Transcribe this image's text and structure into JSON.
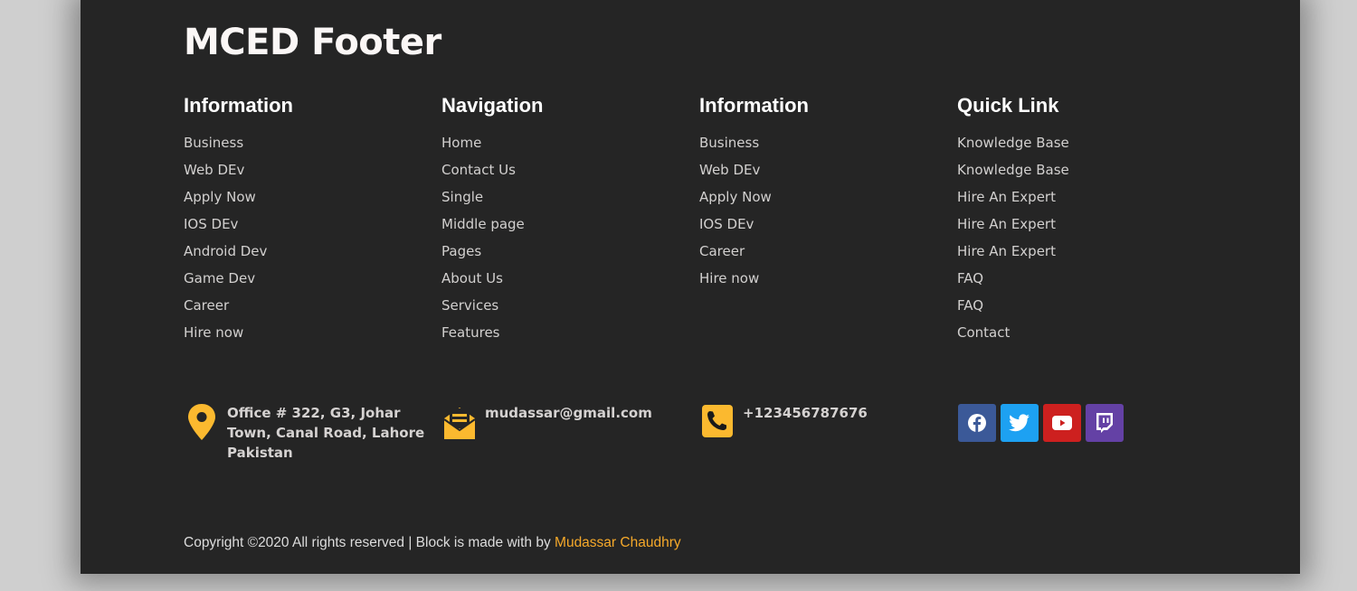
{
  "brand": "MCED Footer",
  "columns": [
    {
      "title": "Information",
      "items": [
        "Business",
        "Web DEv",
        "Apply Now",
        "IOS DEv",
        "Android Dev",
        "Game Dev",
        "Career",
        "Hire now"
      ]
    },
    {
      "title": "Navigation",
      "items": [
        "Home",
        "Contact Us",
        "Single",
        "Middle page",
        "Pages",
        "About Us",
        "Services",
        "Features"
      ]
    },
    {
      "title": "Information",
      "items": [
        "Business",
        "Web DEv",
        "Apply Now",
        "IOS DEv",
        "Career",
        "Hire now"
      ]
    },
    {
      "title": "Quick Link",
      "items": [
        "Knowledge Base",
        "Knowledge Base",
        "Hire An Expert",
        "Hire An Expert",
        "Hire An Expert",
        "FAQ",
        "FAQ",
        "Contact"
      ]
    }
  ],
  "contact": {
    "address": {
      "icon": "map-pin-icon",
      "line1": "Office # 322, G3, Johar",
      "line2": "Town, Canal Road, Lahore",
      "line3": "Pakistan"
    },
    "email": {
      "icon": "envelope-open-icon",
      "value": "mudassar@gmail.com"
    },
    "phone": {
      "icon": "phone-icon",
      "value": "+123456787676"
    }
  },
  "socials": [
    {
      "name": "facebook",
      "icon": "facebook-icon",
      "color": "#3b5998"
    },
    {
      "name": "twitter",
      "icon": "twitter-icon",
      "color": "#1da1f2"
    },
    {
      "name": "youtube",
      "icon": "youtube-icon",
      "color": "#cd201f"
    },
    {
      "name": "twitch",
      "icon": "twitch-icon",
      "color": "#6441a5"
    }
  ],
  "copyright": {
    "text": "Copyright ©2020 All rights reserved | Block is made with by ",
    "author": "Mudassar Chaudhry"
  },
  "colors": {
    "background": "#252525",
    "accent": "#f6a92a",
    "icon": "#fbb92f"
  }
}
